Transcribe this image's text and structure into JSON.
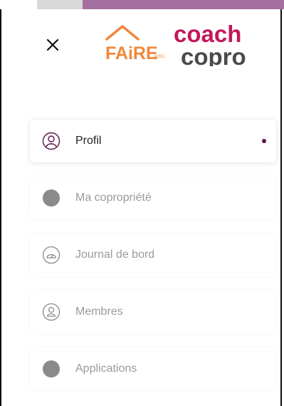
{
  "header": {
    "close_icon": "close-icon",
    "logo": {
      "faire_text": "FAiRE",
      "avec_text": "AVEC",
      "coach_text": "coach",
      "copro_text": "copro",
      "colors": {
        "faire": "#f0883c",
        "coach": "#c2185b",
        "copro": "#4a4a4a"
      }
    }
  },
  "menu": {
    "items": [
      {
        "label": "Profil",
        "icon": "user-circle-icon",
        "active": true
      },
      {
        "label": "Ma copropriété",
        "icon": "circle-filled-icon",
        "active": false
      },
      {
        "label": "Journal de bord",
        "icon": "gauge-icon",
        "active": false
      },
      {
        "label": "Membres",
        "icon": "members-icon",
        "active": false
      },
      {
        "label": "Applications",
        "icon": "circle-filled-icon",
        "active": false
      }
    ],
    "active_indicator_color": "#5a1546"
  }
}
